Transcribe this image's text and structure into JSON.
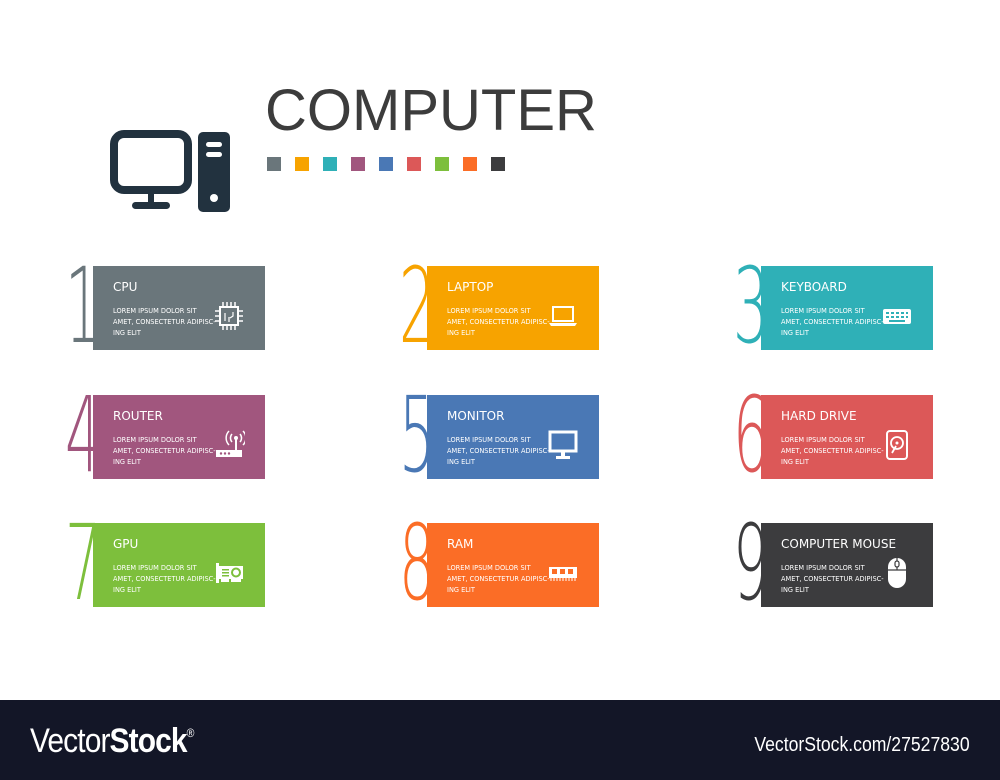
{
  "header": {
    "title": "COMPUTER",
    "icon": "desktop-computer-icon",
    "icon_color": "#22323f",
    "swatches": [
      "#6a767b",
      "#f7a300",
      "#2fb0b7",
      "#a1567e",
      "#4a78b5",
      "#dc5858",
      "#7dbf3c",
      "#fb6d26",
      "#3c3c3e"
    ]
  },
  "items": [
    {
      "number": "1",
      "title": "CPU",
      "text": "Lorem ipsum dolor sit amet, consectetur adipisc-ing elit",
      "icon": "cpu-chip-icon",
      "color": "#6a767b"
    },
    {
      "number": "2",
      "title": "LAPTOP",
      "text": "Lorem ipsum dolor sit amet, consectetur adipisc-ing elit",
      "icon": "laptop-icon",
      "color": "#f7a300"
    },
    {
      "number": "3",
      "title": "KEYBOARD",
      "text": "Lorem ipsum dolor sit amet, consectetur adipisc-ing elit",
      "icon": "keyboard-icon",
      "color": "#2fb0b7"
    },
    {
      "number": "4",
      "title": "ROUTER",
      "text": "Lorem ipsum dolor sit amet, consectetur adipisc-ing elit",
      "icon": "router-icon",
      "color": "#a1567e"
    },
    {
      "number": "5",
      "title": "MONITOR",
      "text": "Lorem ipsum dolor sit amet, consectetur adipisc-ing elit",
      "icon": "monitor-icon",
      "color": "#4a78b5"
    },
    {
      "number": "6",
      "title": "HARD DRIVE",
      "text": "Lorem ipsum dolor sit amet, consectetur adipisc-ing elit",
      "icon": "hard-drive-icon",
      "color": "#dc5858"
    },
    {
      "number": "7",
      "title": "GPU",
      "text": "Lorem ipsum dolor sit amet, consectetur adipisc-ing elit",
      "icon": "gpu-card-icon",
      "color": "#7dbf3c"
    },
    {
      "number": "8",
      "title": "RAM",
      "text": "Lorem ipsum dolor sit amet, consectetur adipisc-ing elit",
      "icon": "ram-module-icon",
      "color": "#fb6d26"
    },
    {
      "number": "9",
      "title": "COMPUTER MOUSE",
      "text": "Lorem ipsum dolor sit amet, consectetur adipisc-ing elit",
      "icon": "computer-mouse-icon",
      "color": "#3c3c3e"
    }
  ],
  "footer": {
    "brand_light": "Vector",
    "brand_bold": "Stock",
    "registered": "®",
    "stock_id": "VectorStock.com/27527830",
    "background": "#131627"
  }
}
